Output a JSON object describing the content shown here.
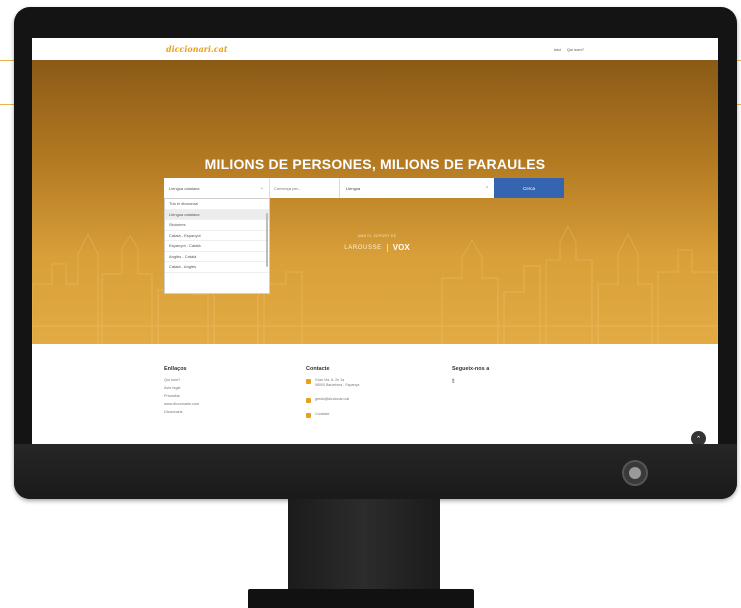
{
  "site": {
    "logo": "diccionari.cat",
    "nav": [
      "Inici",
      "Qui som?"
    ]
  },
  "hero": {
    "title": "MILIONS DE PERSONES, MILIONS DE PARAULES",
    "search": {
      "dictionary_selected": "Llengua catalana",
      "lookup_placeholder": "Comença per...",
      "query_value": "Llengua",
      "clear_glyph": "×",
      "button_label": "Cerca"
    },
    "dropdown_options": [
      "Tria el diccionari",
      "Llengua catalana",
      "Sinònims",
      "Català - Espanyol",
      "Espanyol - Català",
      "Anglès - Català",
      "Català - Anglès"
    ],
    "partner": {
      "caption": "AMB EL SUPORT DE",
      "logos": [
        "LAROUSSE",
        "VOX"
      ]
    }
  },
  "footer": {
    "links": {
      "heading": "Enllaços",
      "items": [
        "Qui som?",
        "Avís legal",
        "Privacitat",
        "www.diccionaris.com",
        "Diccionaris"
      ]
    },
    "contact": {
      "heading": "Contacte",
      "address": [
        "Gran Via, 6. 2n 1a",
        "08000 Barcelona - Espanya"
      ],
      "email": "gestio@diccionari.cat",
      "form": "Contacte"
    },
    "social": {
      "heading": "Segueix-nos a",
      "icon": "twitter-icon"
    }
  },
  "colors": {
    "brand": "#e6a21c",
    "button": "#3565b0"
  }
}
